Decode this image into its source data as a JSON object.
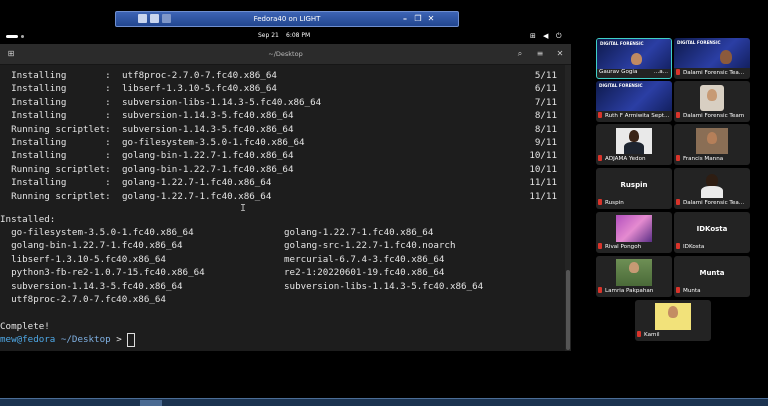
{
  "vm_window": {
    "title": "Fedora40 on LIGHT",
    "controls": [
      "–",
      "❐",
      "✕"
    ]
  },
  "topbar": {
    "date": "Sep 21",
    "time": "6:08 PM",
    "tray_icons": [
      "network-icon",
      "volume-icon",
      "power-icon"
    ]
  },
  "terminal": {
    "title": "~/Desktop",
    "lines": [
      {
        "action": "  Installing       :",
        "pkg": "utf8proc-2.7.0-7.fc40.x86_64",
        "num": "5/11"
      },
      {
        "action": "  Installing       :",
        "pkg": "libserf-1.3.10-5.fc40.x86_64",
        "num": "6/11"
      },
      {
        "action": "  Installing       :",
        "pkg": "subversion-libs-1.14.3-5.fc40.x86_64",
        "num": "7/11"
      },
      {
        "action": "  Installing       :",
        "pkg": "subversion-1.14.3-5.fc40.x86_64",
        "num": "8/11"
      },
      {
        "action": "  Running scriptlet:",
        "pkg": "subversion-1.14.3-5.fc40.x86_64",
        "num": "8/11"
      },
      {
        "action": "  Installing       :",
        "pkg": "go-filesystem-3.5.0-1.fc40.x86_64",
        "num": "9/11"
      },
      {
        "action": "  Installing       :",
        "pkg": "golang-bin-1.22.7-1.fc40.x86_64",
        "num": "10/11"
      },
      {
        "action": "  Running scriptlet:",
        "pkg": "golang-bin-1.22.7-1.fc40.x86_64",
        "num": "10/11"
      },
      {
        "action": "  Installing       :",
        "pkg": "golang-1.22.7-1.fc40.x86_64",
        "num": "11/11"
      },
      {
        "action": "  Running scriptlet:",
        "pkg": "golang-1.22.7-1.fc40.x86_64",
        "num": "11/11"
      }
    ],
    "installed_header": "Installed:",
    "installed": [
      [
        "  go-filesystem-3.5.0-1.fc40.x86_64",
        "golang-1.22.7-1.fc40.x86_64"
      ],
      [
        "  golang-bin-1.22.7-1.fc40.x86_64",
        "golang-src-1.22.7-1.fc40.noarch"
      ],
      [
        "  libserf-1.3.10-5.fc40.x86_64",
        "mercurial-6.7.4-3.fc40.x86_64"
      ],
      [
        "  python3-fb-re2-1.0.7-15.fc40.x86_64",
        "re2-1:20220601-19.fc40.x86_64"
      ],
      [
        "  subversion-1.14.3-5.fc40.x86_64",
        "subversion-libs-1.14.3-5.fc40.x86_64"
      ],
      [
        "  utf8proc-2.7.0-7.fc40.x86_64",
        ""
      ]
    ],
    "complete": "Complete!",
    "prompt_user": "mew@fedora",
    "prompt_path": " ~/Desktop",
    "prompt_symbol": ">"
  },
  "slide_title": "DIGITAL FORENSIC",
  "participants": [
    "Gaurav Gogia",
    "Dalami Forensic Tea...",
    "Ruth F Armiwita Sept...",
    "Dalami Forensic Team",
    "ADJAMA Yedon",
    "Francis Manna",
    "Ruspin",
    "Dalami Forensic Tea...",
    "Rival Pongoh",
    "IDKosta",
    "Lamria Pakpahan",
    "Munta",
    "Kamil"
  ],
  "placeholder_names": [
    "Ruspin",
    "IDKosta",
    "Munta"
  ],
  "active_speaker_ellipsis": "...a..."
}
